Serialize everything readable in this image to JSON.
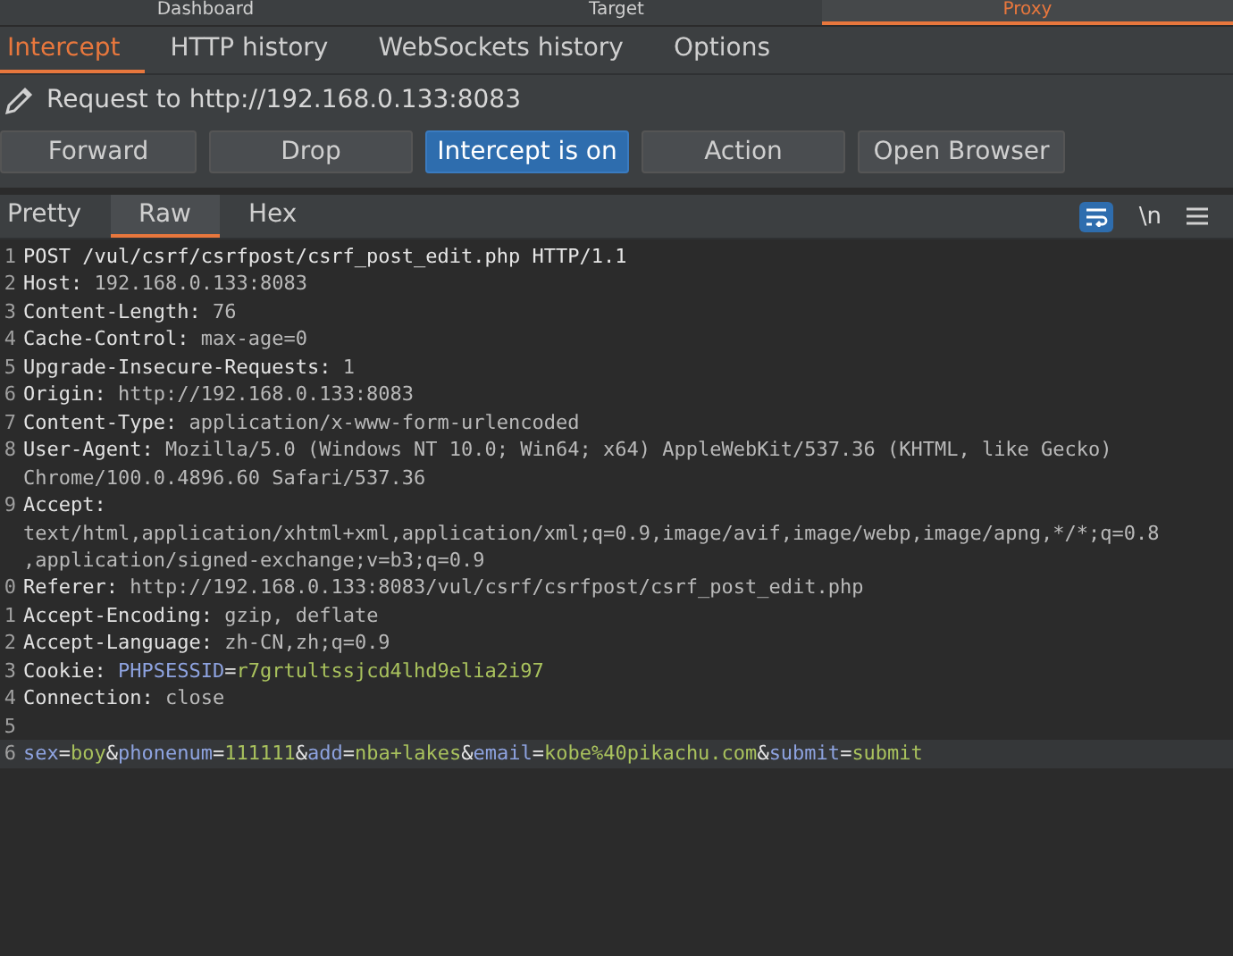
{
  "top_tabs": [
    {
      "label": "Dashboard",
      "selected": false
    },
    {
      "label": "Target",
      "selected": false
    },
    {
      "label": "Proxy",
      "selected": true
    }
  ],
  "proxy_tabs": [
    {
      "label": "Intercept",
      "selected": true
    },
    {
      "label": "HTTP history",
      "selected": false
    },
    {
      "label": "WebSockets history",
      "selected": false
    },
    {
      "label": "Options",
      "selected": false
    }
  ],
  "request_label": "Request to http://192.168.0.133:8083",
  "buttons": [
    {
      "label": "Forward",
      "on": false
    },
    {
      "label": "Drop",
      "on": false
    },
    {
      "label": "Intercept is on",
      "on": true
    },
    {
      "label": "Action",
      "on": false
    },
    {
      "label": "Open Browser",
      "on": false
    }
  ],
  "editor_tabs": [
    {
      "label": "Pretty",
      "selected": false
    },
    {
      "label": "Raw",
      "selected": true
    },
    {
      "label": "Hex",
      "selected": false
    }
  ],
  "editor_tools": {
    "wrap_on": true,
    "newline_label": "\\n"
  },
  "lines": [
    {
      "number": "1",
      "highlighted": false,
      "segments": [
        {
          "kind": "plain",
          "text": "POST /vul/csrf/csrfpost/csrf_post_edit.php HTTP/1.1"
        }
      ]
    },
    {
      "number": "2",
      "highlighted": false,
      "segments": [
        {
          "kind": "name",
          "text": "Host: "
        },
        {
          "kind": "value",
          "text": "192.168.0.133:8083"
        }
      ]
    },
    {
      "number": "3",
      "highlighted": false,
      "segments": [
        {
          "kind": "name",
          "text": "Content-Length: "
        },
        {
          "kind": "value",
          "text": "76"
        }
      ]
    },
    {
      "number": "4",
      "highlighted": false,
      "segments": [
        {
          "kind": "name",
          "text": "Cache-Control: "
        },
        {
          "kind": "value",
          "text": "max-age=0"
        }
      ]
    },
    {
      "number": "5",
      "highlighted": false,
      "segments": [
        {
          "kind": "name",
          "text": "Upgrade-Insecure-Requests: "
        },
        {
          "kind": "value",
          "text": "1"
        }
      ]
    },
    {
      "number": "6",
      "highlighted": false,
      "segments": [
        {
          "kind": "name",
          "text": "Origin: "
        },
        {
          "kind": "value",
          "text": "http://192.168.0.133:8083"
        }
      ]
    },
    {
      "number": "7",
      "highlighted": false,
      "segments": [
        {
          "kind": "name",
          "text": "Content-Type: "
        },
        {
          "kind": "value",
          "text": "application/x-www-form-urlencoded"
        }
      ]
    },
    {
      "number": "8",
      "highlighted": false,
      "segments": [
        {
          "kind": "name",
          "text": "User-Agent: "
        },
        {
          "kind": "value",
          "text": "Mozilla/5.0 (Windows NT 10.0; Win64; x64) AppleWebKit/537.36 (KHTML, like Gecko)"
        }
      ]
    },
    {
      "highlighted": false,
      "segments": [
        {
          "kind": "value",
          "text": "Chrome/100.0.4896.60 Safari/537.36"
        }
      ]
    },
    {
      "number": "9",
      "highlighted": false,
      "segments": [
        {
          "kind": "name",
          "text": "Accept:"
        }
      ]
    },
    {
      "highlighted": false,
      "segments": [
        {
          "kind": "value",
          "text": "text/html,application/xhtml+xml,application/xml;q=0.9,image/avif,image/webp,image/apng,*/*;q=0.8"
        }
      ]
    },
    {
      "highlighted": false,
      "segments": [
        {
          "kind": "value",
          "text": ",application/signed-exchange;v=b3;q=0.9"
        }
      ]
    },
    {
      "number": "0",
      "highlighted": false,
      "segments": [
        {
          "kind": "name",
          "text": "Referer: "
        },
        {
          "kind": "value",
          "text": "http://192.168.0.133:8083/vul/csrf/csrfpost/csrf_post_edit.php"
        }
      ]
    },
    {
      "number": "1",
      "highlighted": false,
      "segments": [
        {
          "kind": "name",
          "text": "Accept-Encoding: "
        },
        {
          "kind": "value",
          "text": "gzip, deflate"
        }
      ]
    },
    {
      "number": "2",
      "highlighted": false,
      "segments": [
        {
          "kind": "name",
          "text": "Accept-Language: "
        },
        {
          "kind": "value",
          "text": "zh-CN,zh;q=0.9"
        }
      ]
    },
    {
      "number": "3",
      "highlighted": false,
      "segments": [
        {
          "kind": "name",
          "text": "Cookie: "
        },
        {
          "kind": "key",
          "text": "PHPSESSID"
        },
        {
          "kind": "plain",
          "text": "="
        },
        {
          "kind": "green",
          "text": "r7grtultssjcd4lhd9elia2i97"
        }
      ]
    },
    {
      "number": "4",
      "highlighted": false,
      "segments": [
        {
          "kind": "name",
          "text": "Connection: "
        },
        {
          "kind": "value",
          "text": "close"
        }
      ]
    },
    {
      "number": "5",
      "highlighted": false
    },
    {
      "number": "6",
      "highlighted": true,
      "segments": [
        {
          "kind": "key",
          "text": "sex"
        },
        {
          "kind": "plain",
          "text": "="
        },
        {
          "kind": "green",
          "text": "boy"
        },
        {
          "kind": "plain",
          "text": "&"
        },
        {
          "kind": "key",
          "text": "phonenum"
        },
        {
          "kind": "plain",
          "text": "="
        },
        {
          "kind": "green",
          "text": "111111"
        },
        {
          "kind": "plain",
          "text": "&"
        },
        {
          "kind": "key",
          "text": "add"
        },
        {
          "kind": "plain",
          "text": "="
        },
        {
          "kind": "green",
          "text": "nba+lakes"
        },
        {
          "kind": "plain",
          "text": "&"
        },
        {
          "kind": "key",
          "text": "email"
        },
        {
          "kind": "plain",
          "text": "="
        },
        {
          "kind": "green",
          "text": "kobe%40pikachu.com"
        },
        {
          "kind": "plain",
          "text": "&"
        },
        {
          "kind": "key",
          "text": "submit"
        },
        {
          "kind": "plain",
          "text": "="
        },
        {
          "kind": "green",
          "text": "submit"
        }
      ]
    }
  ]
}
